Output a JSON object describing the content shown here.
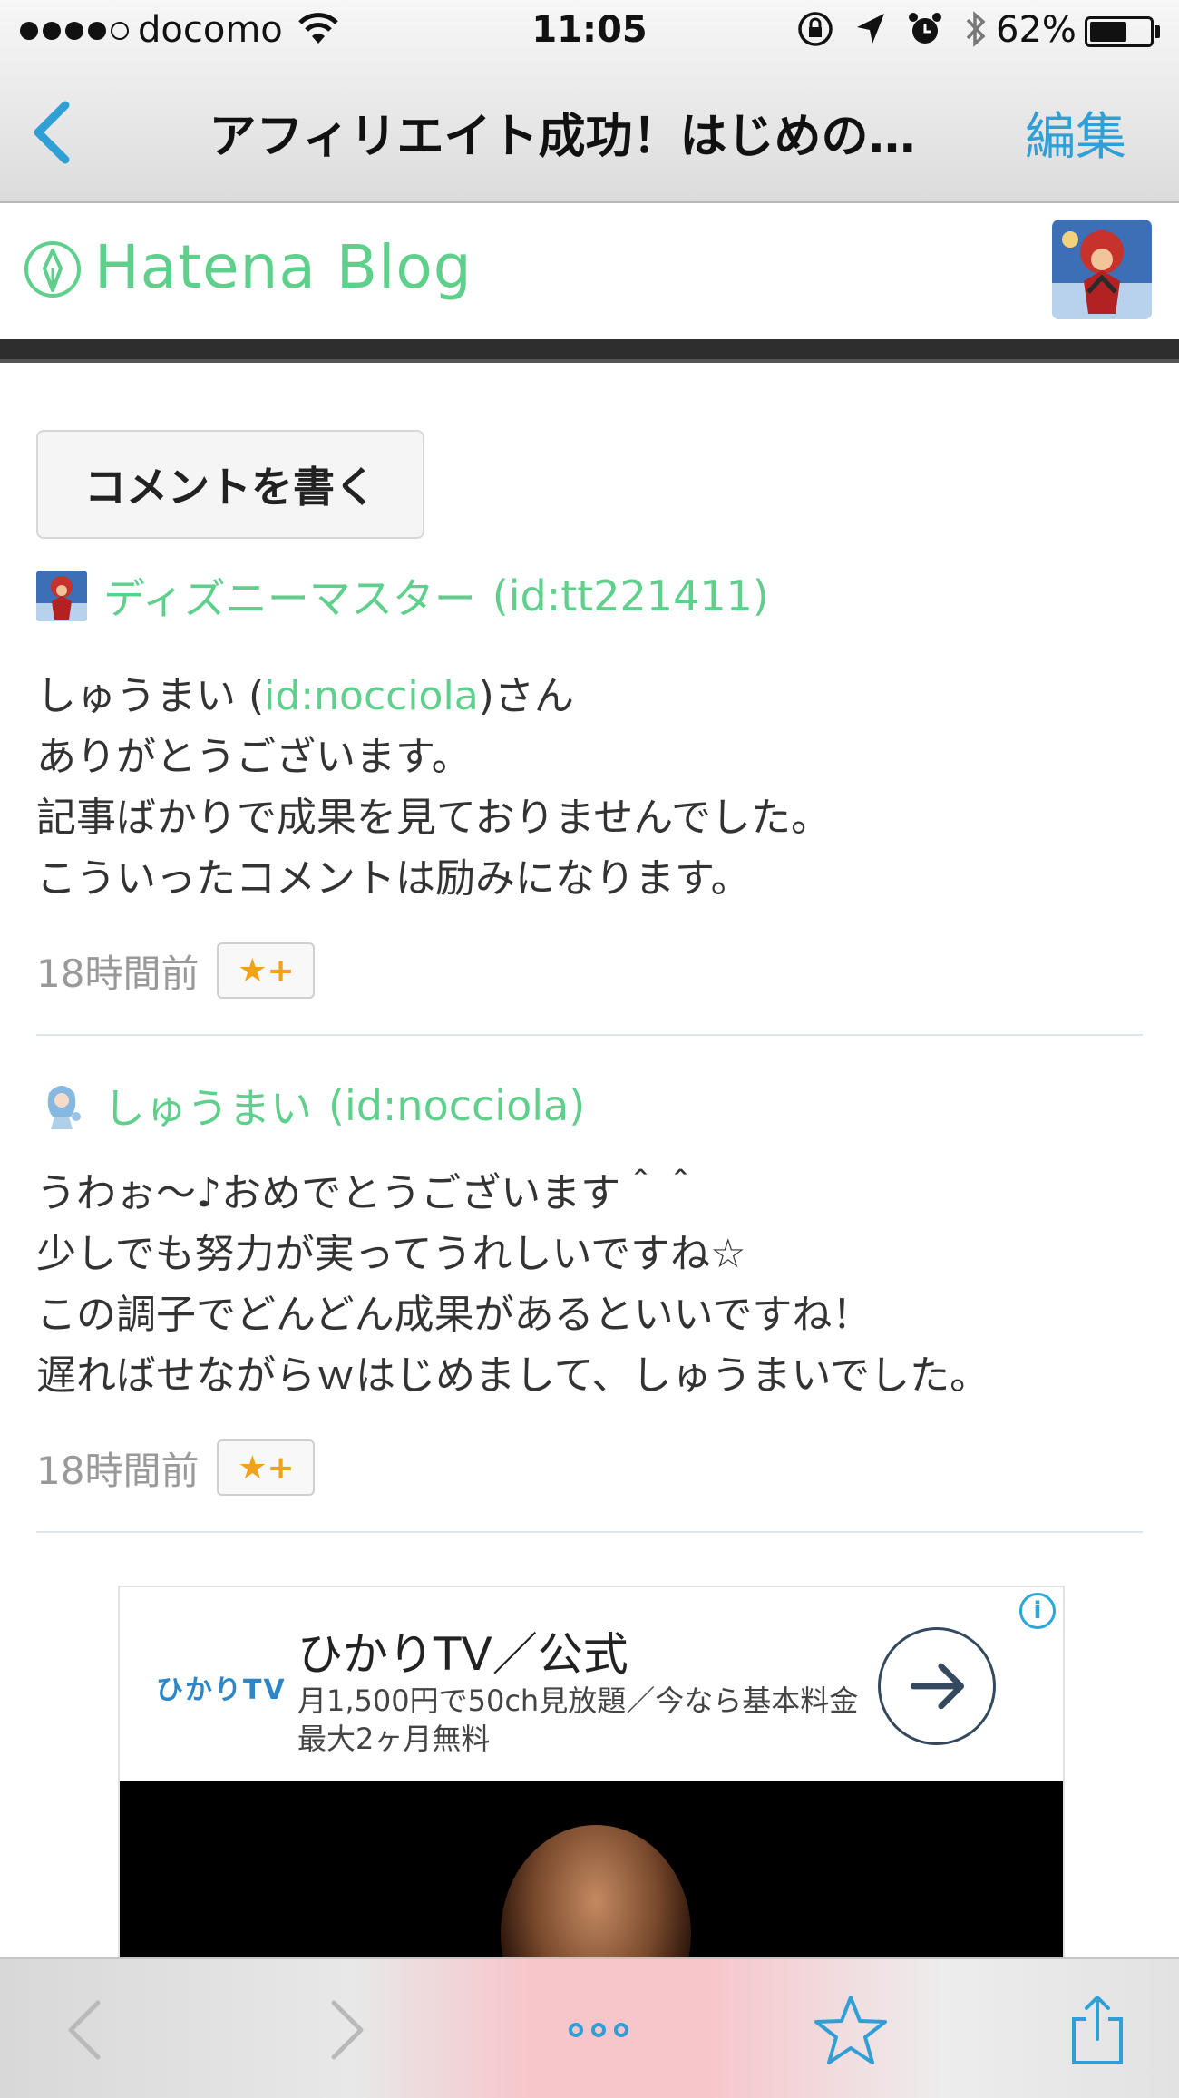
{
  "status_bar": {
    "carrier": "docomo",
    "time": "11:05",
    "battery_percent": "62%",
    "battery_level": 0.62,
    "icons": [
      "wifi-icon",
      "rotation-lock-icon",
      "location-icon",
      "alarm-icon",
      "bluetooth-icon",
      "battery-icon"
    ]
  },
  "nav": {
    "title": "アフィリエイト成功！はじめの…",
    "edit": "編集"
  },
  "header": {
    "logo_text": "Hatena Blog"
  },
  "comment_button": "コメントを書く",
  "comments": [
    {
      "author": "ディズニーマスター",
      "author_id": "(id:tt221411)",
      "lines": [
        {
          "pre": "しゅうまい (",
          "link": "id:nocciola",
          "post": ")さん"
        },
        {
          "pre": "ありがとうございます。",
          "link": "",
          "post": ""
        },
        {
          "pre": "記事ばかりで成果を見ておりませんでした。",
          "link": "",
          "post": ""
        },
        {
          "pre": "こういったコメントは励みになります。",
          "link": "",
          "post": ""
        }
      ],
      "time": "18時間前",
      "star": "★+"
    },
    {
      "author": "しゅうまい",
      "author_id": "(id:nocciola)",
      "lines": [
        {
          "pre": "うわぉ〜♪おめでとうございます＾＾",
          "link": "",
          "post": ""
        },
        {
          "pre": "少しでも努力が実ってうれしいですね☆",
          "link": "",
          "post": ""
        },
        {
          "pre": "この調子でどんどん成果があるといいですね！",
          "link": "",
          "post": ""
        },
        {
          "pre": "遅ればせながらｗはじめまして、しゅうまいでした。",
          "link": "",
          "post": ""
        }
      ],
      "time": "18時間前",
      "star": "★+"
    }
  ],
  "ad": {
    "logo": "ひかりTV",
    "title": "ひかりTV／公式",
    "description": "月1,500円で50ch見放題／今なら基本料金最大2ヶ月無料",
    "info": "i"
  },
  "toolbar": {
    "items": [
      "back-icon",
      "forward-icon",
      "more-icon",
      "bookmark-star-icon",
      "share-icon"
    ]
  },
  "colors": {
    "hatena_green": "#5fcf8c",
    "ios_blue": "#2f9fd6",
    "star_orange": "#f0a21c"
  }
}
